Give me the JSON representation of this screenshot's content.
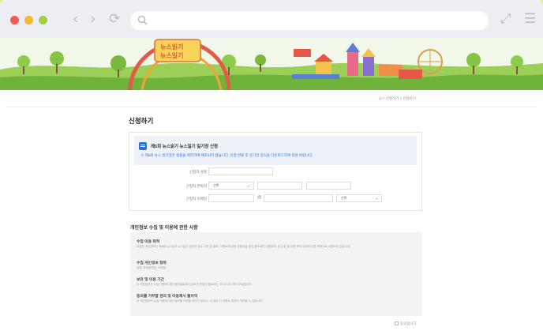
{
  "browser": {
    "back_glyph": "‹",
    "forward_glyph": "›",
    "reload_glyph": "⟳",
    "url_value": "",
    "expand_glyph": "⤢",
    "menu_glyph": "☰",
    "traffic_lights": [
      "#f05b55",
      "#f5b832",
      "#a2cd46"
    ]
  },
  "banner": {
    "sign_text_1": "뉴스읽기",
    "sign_text_2": "뉴스일기"
  },
  "breadcrumb": {
    "home_icon": "home-icon",
    "items": [
      "신청하기",
      "신청하기"
    ]
  },
  "page": {
    "title": "신청하기"
  },
  "application": {
    "title": "제5회 뉴스읽기 뉴스일기 일기장 신청",
    "notice": "※ 제5회 뉴스 일기장은 실물을 제작하여 배포되지 않습니다. 신청 완료 후 일기장 양식을 다운로드하여 작성 바랍니다.",
    "fields": {
      "name_label": "신청자 성명",
      "phone_label": "신청자 연락처",
      "phone_prefix": "선택",
      "email_label": "신청자 이메일",
      "email_at": "@",
      "email_domain": "선택"
    }
  },
  "privacy": {
    "section_title": "개인정보 수집 및 이용에 관한 사항",
    "purpose_title": "수집 이용 목적",
    "purpose_body": "수집된 개인정보는 제5회 뉴스읽기 뉴스일기 공모전 접수 시작 및 홍보, 이벤트에 대한 경품지급 등의 용도로만 사용되며, 본 수집 및 이용 목적 이외의 다른 목적으로 사용되지 않습니다.",
    "items_title": "수집 개인정보 항목",
    "items_body": "성명, 휴대폰번호, 이메일",
    "period_title": "보유 및 이용 기간",
    "period_body": "이 개인정보는 수집 이용에 대한 동의일로부터 공모전 운영이 종료되는 '23.12.31' 까지 보유됩니다.",
    "refuse_title": "동의를 거부할 권리 및 이용제시 불이익",
    "refuse_body": "이 개인정보의 수집 이용에 대한 동의를 거부할 권리가 있으나, 이 경우 이 이벤트 참여가 거부될 수 있습니다.",
    "agree_label": "동의합니다"
  }
}
